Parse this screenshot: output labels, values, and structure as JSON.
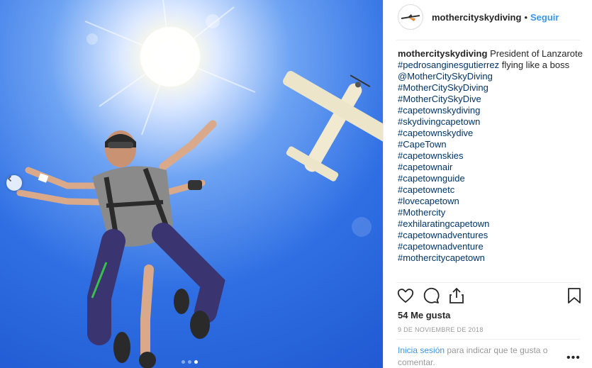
{
  "post": {
    "username": "mothercityskydiving",
    "separator": "•",
    "follow_label": "Seguir",
    "caption_text": "President of Lanzarote",
    "caption_tags": [
      "#pedrosanginesgutierrez",
      "@MotherCitySkyDiving",
      "#MotherCitySkyDiving",
      "#MotherCitySkyDive",
      "#capetownskydiving",
      "#skydivingcapetown",
      "#capetownskydive",
      "#CapeTown",
      "#capetownskies",
      "#capetownair",
      "#capetownguide",
      "#capetownetc",
      "#lovecapetown",
      "#Mothercity",
      "#exhilaratingcapetown",
      "#capetownadventures",
      "#capetownadventure",
      "#mothercitycapetown"
    ],
    "caption_after_first_tag": " flying like a boss",
    "likes": "54 Me gusta",
    "date": "9 DE NOVIEMBRE DE 2018",
    "login_link": "Inicia sesión",
    "login_text": " para indicar que te gusta o comentar.",
    "more_label": "•••"
  },
  "carousel": {
    "total": 3,
    "active": 2
  },
  "icons": {
    "like": "heart-icon",
    "comment": "comment-icon",
    "share": "share-icon",
    "save": "bookmark-icon",
    "prev": "chevron-left-icon"
  },
  "colors": {
    "link": "#003569",
    "accent": "#3897f0",
    "muted": "#999999"
  }
}
